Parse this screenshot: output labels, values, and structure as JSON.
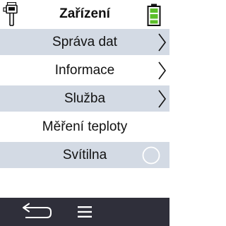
{
  "header": {
    "title": "Zařízení",
    "left_icon": "device-icon",
    "right_icon": "battery-full-icon"
  },
  "menu": {
    "items": [
      {
        "label": "Správa dat",
        "shaded": true,
        "trailing": "chevron-right-icon"
      },
      {
        "label": "Informace",
        "shaded": false,
        "trailing": "chevron-right-icon"
      },
      {
        "label": "Služba",
        "shaded": true,
        "trailing": "chevron-right-icon"
      },
      {
        "label": "Měření teploty",
        "shaded": false,
        "trailing": ""
      },
      {
        "label": "Svítilna",
        "shaded": true,
        "trailing": "toggle-off-icon",
        "toggle_on": false
      }
    ]
  },
  "footer": {
    "left_icon": "back-arrow-icon",
    "center_icon": "hamburger-menu-icon"
  },
  "colors": {
    "row_shade": "#d3dae4",
    "footer_bg": "#2f2f3a",
    "battery_fill": "#5cbf2a"
  }
}
